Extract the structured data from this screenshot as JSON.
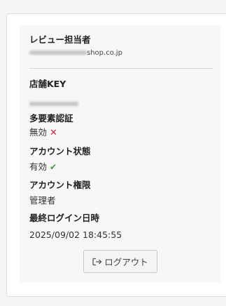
{
  "reviewer": {
    "label": "レビュー担当者",
    "email_suffix": "shop.co.jp"
  },
  "store_key": {
    "label": "店舗KEY"
  },
  "mfa": {
    "label": "多要素認証",
    "value": "無効",
    "status_icon": "cross-icon",
    "status_color": "#d7263d"
  },
  "account_status": {
    "label": "アカウント状態",
    "value": "有効",
    "status_icon": "check-icon",
    "status_color": "#3b9d44"
  },
  "account_role": {
    "label": "アカウント権限",
    "value": "管理者"
  },
  "last_login": {
    "label": "最終ログイン日時",
    "value": "2025/09/02 18:45:55"
  },
  "logout": {
    "label": "ログアウト",
    "icon": "logout-icon"
  }
}
